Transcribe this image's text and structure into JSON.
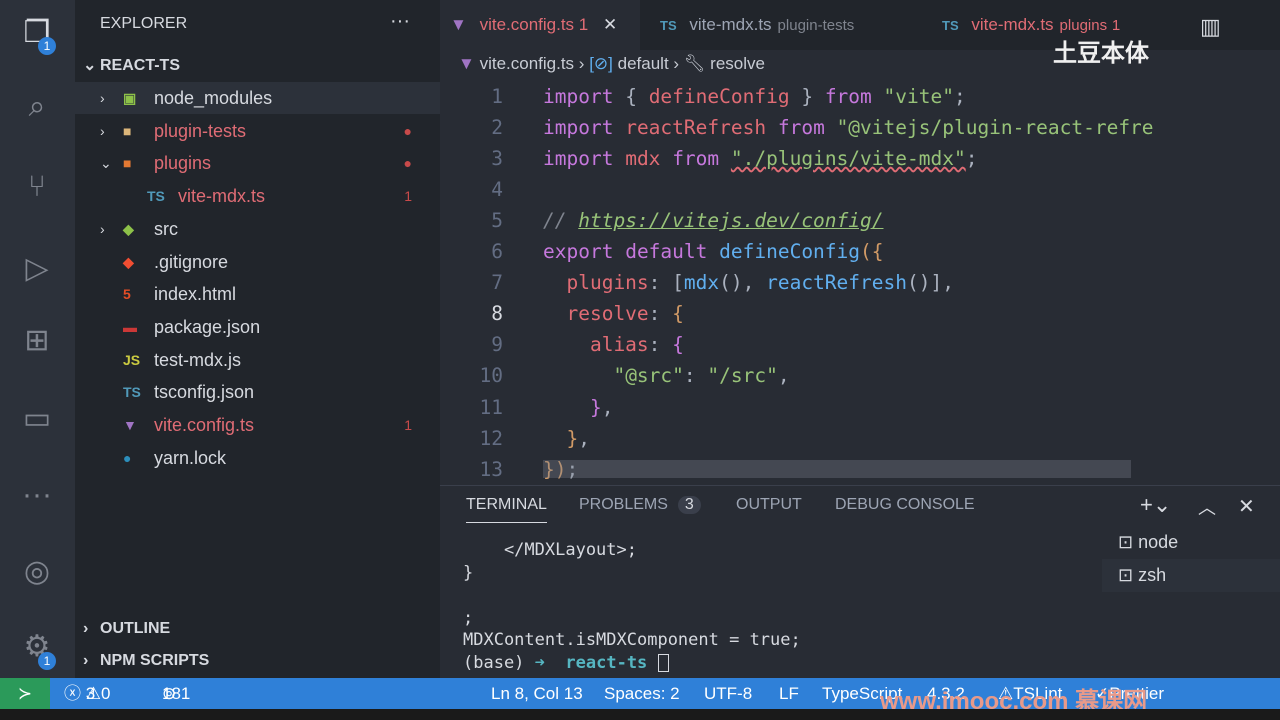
{
  "activity": {
    "explorer_badge": "1",
    "settings_badge": "1"
  },
  "sidebar": {
    "title": "EXPLORER",
    "more": "···",
    "project": "REACT-TS",
    "items": [
      {
        "label": "node_modules",
        "chev": "›",
        "icon": "▣",
        "color": "#8dc149",
        "red": false,
        "count": ""
      },
      {
        "label": "plugin-tests",
        "chev": "›",
        "icon": "■",
        "color": "#dcb67a",
        "red": true,
        "count": "●"
      },
      {
        "label": "plugins",
        "chev": "⌄",
        "icon": "■",
        "color": "#e37933",
        "red": true,
        "count": "●"
      },
      {
        "label": "vite-mdx.ts",
        "chev": "",
        "icon": "TS",
        "color": "#519aba",
        "red": true,
        "count": "1"
      },
      {
        "label": "src",
        "chev": "›",
        "icon": "◆",
        "color": "#8dc149",
        "red": false,
        "count": ""
      },
      {
        "label": ".gitignore",
        "chev": "",
        "icon": "◆",
        "color": "#f14e32",
        "red": false,
        "count": ""
      },
      {
        "label": "index.html",
        "chev": "",
        "icon": "5",
        "color": "#e44d26",
        "red": false,
        "count": ""
      },
      {
        "label": "package.json",
        "chev": "",
        "icon": "▬",
        "color": "#cb3837",
        "red": false,
        "count": ""
      },
      {
        "label": "test-mdx.js",
        "chev": "",
        "icon": "JS",
        "color": "#cbcb41",
        "red": false,
        "count": ""
      },
      {
        "label": "tsconfig.json",
        "chev": "",
        "icon": "TS",
        "color": "#519aba",
        "red": false,
        "count": ""
      },
      {
        "label": "vite.config.ts",
        "chev": "",
        "icon": "▼",
        "color": "#a074c4",
        "red": true,
        "count": "1"
      },
      {
        "label": "yarn.lock",
        "chev": "",
        "icon": "●",
        "color": "#2c8ebb",
        "red": false,
        "count": ""
      }
    ],
    "outline": "OUTLINE",
    "npm": "NPM SCRIPTS"
  },
  "tabs": [
    {
      "label": "vite.config.ts",
      "sub": "",
      "count": "1",
      "icon": "▼",
      "active": true
    },
    {
      "label": "vite-mdx.ts",
      "sub": "plugin-tests",
      "count": "",
      "icon": "TS",
      "active": false
    },
    {
      "label": "vite-mdx.ts",
      "sub": "plugins",
      "count": "1",
      "icon": "TS",
      "active": false
    }
  ],
  "breadcrumb": {
    "file": "vite.config.ts",
    "symbol1": "default",
    "symbol2": "resolve"
  },
  "watermark": "土豆本体",
  "editor": {
    "current_line": 8,
    "lines": [
      [
        [
          "import",
          "kw"
        ],
        [
          " { ",
          "pl"
        ],
        [
          "defineConfig",
          "var"
        ],
        [
          " } ",
          "pl"
        ],
        [
          "from",
          "kw"
        ],
        [
          " ",
          "pl"
        ],
        [
          "\"vite\"",
          "str"
        ],
        [
          ";",
          "pl"
        ]
      ],
      [
        [
          "import",
          "kw"
        ],
        [
          " ",
          "pl"
        ],
        [
          "reactRefresh",
          "var"
        ],
        [
          " ",
          "pl"
        ],
        [
          "from",
          "kw"
        ],
        [
          " ",
          "pl"
        ],
        [
          "\"@vitejs/plugin-react-refre",
          "str"
        ]
      ],
      [
        [
          "import",
          "kw"
        ],
        [
          " ",
          "pl"
        ],
        [
          "mdx",
          "var"
        ],
        [
          " ",
          "pl"
        ],
        [
          "from",
          "kw"
        ],
        [
          " ",
          "pl"
        ],
        [
          "\"./plugins/vite-mdx\"",
          "str sq"
        ],
        [
          ";",
          "pl"
        ]
      ],
      [],
      [
        [
          "// ",
          "cm"
        ],
        [
          "https://vitejs.dev/config/",
          "url cm"
        ]
      ],
      [
        [
          "export",
          "kw"
        ],
        [
          " ",
          "pl"
        ],
        [
          "default",
          "kw"
        ],
        [
          " ",
          "pl"
        ],
        [
          "defineConfig",
          "fn"
        ],
        [
          "({",
          "br"
        ]
      ],
      [
        [
          "  plugins",
          "var"
        ],
        [
          ": [",
          "pl"
        ],
        [
          "mdx",
          "fn"
        ],
        [
          "(), ",
          "pl"
        ],
        [
          "reactRefresh",
          "fn"
        ],
        [
          "()],",
          "pl"
        ]
      ],
      [
        [
          "  resolve",
          "var"
        ],
        [
          ": ",
          "pl"
        ],
        [
          "{",
          "br"
        ]
      ],
      [
        [
          "    alias",
          "var"
        ],
        [
          ": ",
          "pl"
        ],
        [
          "{",
          "kw"
        ]
      ],
      [
        [
          "      ",
          "pl"
        ],
        [
          "\"@src\"",
          "str"
        ],
        [
          ": ",
          "pl"
        ],
        [
          "\"/src\"",
          "str"
        ],
        [
          ",",
          "pl"
        ]
      ],
      [
        [
          "    ",
          "pl"
        ],
        [
          "}",
          "kw"
        ],
        [
          ",",
          "pl"
        ]
      ],
      [
        [
          "  ",
          "pl"
        ],
        [
          "}",
          "br"
        ],
        [
          ",",
          "pl"
        ]
      ],
      [
        [
          "})",
          "br"
        ],
        [
          ";",
          "pl"
        ]
      ]
    ]
  },
  "panel": {
    "tabs": [
      "TERMINAL",
      "PROBLEMS",
      "OUTPUT",
      "DEBUG CONSOLE"
    ],
    "problems_count": "3",
    "terminal_lines": [
      "    </MDXLayout>;",
      "}",
      "",
      ";",
      "MDXContent.isMDXComponent = true;"
    ],
    "prompt_env": "(base)",
    "prompt_arrow": "➜",
    "prompt_dir": "react-ts",
    "terminals": [
      "node",
      "zsh"
    ]
  },
  "status": {
    "errors": "3",
    "warnings": "0",
    "ports": "181",
    "position": "Ln 8, Col 13",
    "spaces": "Spaces: 2",
    "encoding": "UTF-8",
    "eol": "LF",
    "language": "TypeScript",
    "version": "4.3.2",
    "tslint": "TSLint",
    "prettier": "Prettier",
    "imooc": "www.imooc.com 慕课网"
  }
}
